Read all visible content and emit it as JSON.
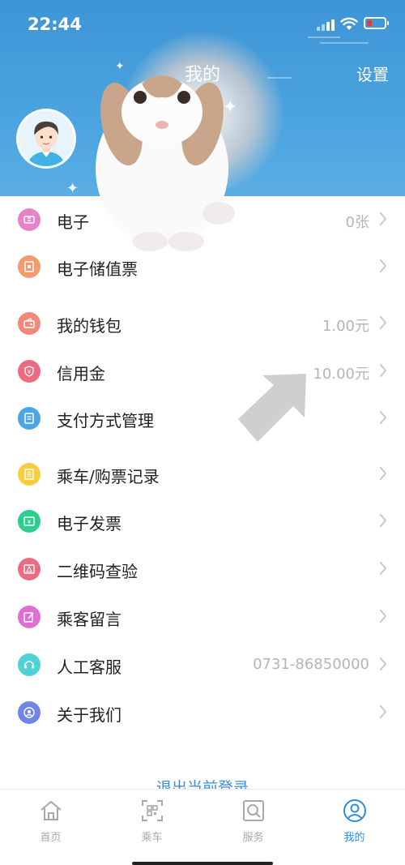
{
  "status_bar": {
    "time": "22:44"
  },
  "header": {
    "title": "我的",
    "settings": "设置"
  },
  "menu": {
    "e_ticket": {
      "label": "电子",
      "value": "0张"
    },
    "stored_value": {
      "label": "电子储值票"
    },
    "wallet": {
      "label": "我的钱包",
      "value": "1.00元"
    },
    "credit": {
      "label": "信用金",
      "value": "10.00元"
    },
    "payment": {
      "label": "支付方式管理"
    },
    "records": {
      "label": "乘车/购票记录"
    },
    "invoice": {
      "label": "电子发票"
    },
    "qrcheck": {
      "label": "二维码查验"
    },
    "message": {
      "label": "乘客留言"
    },
    "service": {
      "label": "人工客服",
      "value": "0731-86850000"
    },
    "about": {
      "label": "关于我们"
    }
  },
  "logout": "退出当前登录",
  "tabs": [
    {
      "label": "首页",
      "icon": "home-icon"
    },
    {
      "label": "乘车",
      "icon": "qr-scan-icon"
    },
    {
      "label": "服务",
      "icon": "search-service-icon"
    },
    {
      "label": "我的",
      "icon": "user-icon",
      "active": true
    }
  ],
  "colors": {
    "header": "#4ba3df",
    "active_tab": "#2f8fd8",
    "icon_pink": "#e784c9",
    "icon_orange": "#f29b6c",
    "icon_salmon": "#f2887a",
    "icon_red": "#ec6b80",
    "icon_blue": "#4aa6e8",
    "icon_yellow": "#f6cd3c",
    "icon_green": "#2ecc8e",
    "icon_teal": "#4fd2d6",
    "icon_indigo": "#6e86e6"
  }
}
